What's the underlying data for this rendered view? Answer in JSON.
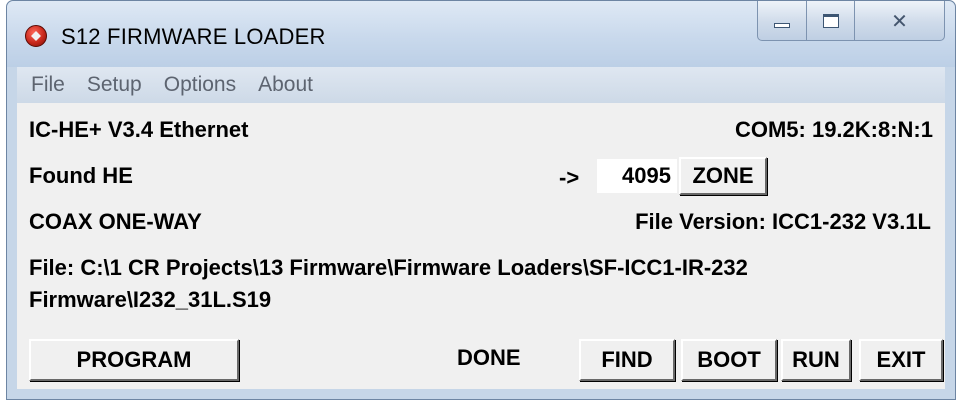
{
  "window": {
    "title": "S12 FIRMWARE LOADER",
    "controls": {
      "minimize": "—",
      "maximize": "□",
      "close": "✕"
    }
  },
  "menu": {
    "items": [
      "File",
      "Setup",
      "Options",
      "About"
    ]
  },
  "status": {
    "device": "IC-HE+ V3.4  Ethernet",
    "port": "COM5: 19.2K:8:N:1",
    "found": "Found HE",
    "arrow": "->",
    "zone_value": "4095",
    "mode": "COAX ONE-WAY",
    "file_version": "File Version: ICC1-232 V3.1L",
    "file_path_line1": "File: C:\\1 CR Projects\\13 Firmware\\Firmware Loaders\\SF-ICC1-IR-232",
    "file_path_line2": "Firmware\\I232_31L.S19",
    "result": "DONE"
  },
  "buttons": {
    "zone": "ZONE",
    "program": "PROGRAM",
    "find": "FIND",
    "boot": "BOOT",
    "run": "RUN",
    "exit": "EXIT"
  },
  "colors": {
    "frame": "#c6d6e8",
    "client": "#f0f0f0",
    "icon_red": "#c8281c"
  }
}
